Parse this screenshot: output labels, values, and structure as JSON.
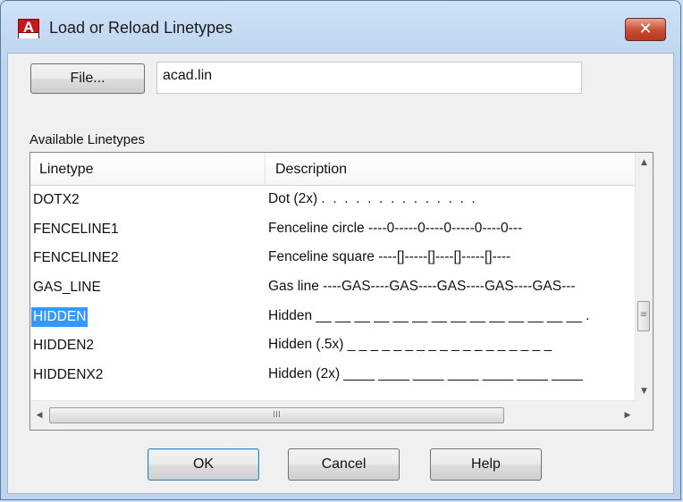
{
  "window": {
    "title": "Load or Reload Linetypes",
    "close_glyph": "✕",
    "app_icon": "A"
  },
  "file": {
    "button_label": "File...",
    "value": "acad.lin"
  },
  "list": {
    "label": "Available Linetypes",
    "columns": [
      "Linetype",
      "Description"
    ],
    "rows": [
      {
        "name": "DOTX2",
        "description": "Dot (2x) .  .  .  .  .  .  .  .  .  .  .  .  .  ."
      },
      {
        "name": "FENCELINE1",
        "description": "Fenceline circle ----0-----0----0-----0----0---"
      },
      {
        "name": "FENCELINE2",
        "description": "Fenceline square ----[]-----[]----[]-----[]----"
      },
      {
        "name": "GAS_LINE",
        "description": "Gas line ----GAS----GAS----GAS----GAS----GAS---"
      },
      {
        "name": "HIDDEN",
        "description": "Hidden __ __ __ __ __ __ __ __ __ __ __ __ __ __ .",
        "selected": true
      },
      {
        "name": "HIDDEN2",
        "description": "Hidden (.5x) _ _ _ _ _ _ _ _ _ _ _ _ _ _ _ _ _ _"
      },
      {
        "name": "HIDDENX2",
        "description": "Hidden (2x) ____ ____ ____ ____ ____ ____ ____"
      }
    ],
    "hscroll_grip": "III",
    "vscroll_grip": "≡"
  },
  "buttons": {
    "ok": "OK",
    "cancel": "Cancel",
    "help": "Help"
  },
  "colors": {
    "selection": "#3399ff",
    "close_button": "#c84a31"
  }
}
